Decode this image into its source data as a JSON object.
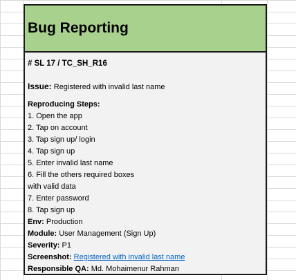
{
  "header": {
    "title": "Bug Reporting"
  },
  "report": {
    "id": "# SL 17 / TC_SH_R16",
    "issue_label": "Issue:",
    "issue_value": "Registered with invalid last name",
    "steps_label": "Reproducing Steps:",
    "steps": [
      "1. Open the app",
      "2. Tap on account",
      "3. Tap sign up/ login",
      "4. Tap sign up",
      "5. Enter invalid last name",
      "6. Fill the others required boxes",
      "with valid data",
      "7. Enter password",
      "8. Tap sign up"
    ],
    "env_label": "Env:",
    "env_value": "Production",
    "module_label": "Module:",
    "module_value": "User Management (Sign Up)",
    "severity_label": "Severity:",
    "severity_value": "P1",
    "screenshot_label": "Screenshot:",
    "screenshot_link": "Registered with invalid last name",
    "qa_label": "Responsible QA:",
    "qa_value": "Md. Mohaimenur Rahman"
  },
  "colors": {
    "header_bg": "#a9d18e",
    "card_bg": "#f2f2f2",
    "link": "#0563c1",
    "gridline": "#d9d9d9"
  }
}
